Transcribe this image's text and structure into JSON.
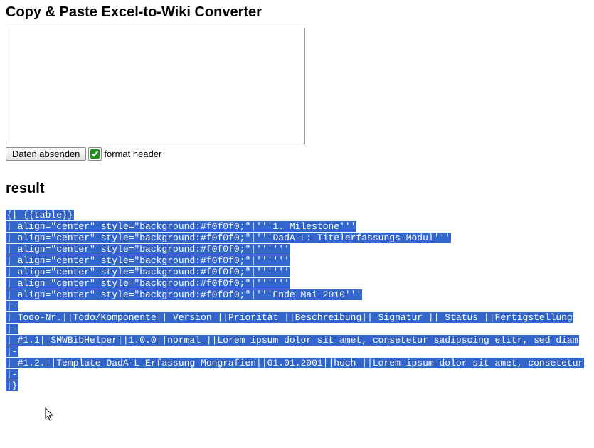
{
  "heading": "Copy & Paste Excel-to-Wiki Converter",
  "input": {
    "value": "",
    "placeholder": ""
  },
  "submit_label": "Daten absenden",
  "format_header": {
    "checked": true,
    "label": "format header"
  },
  "result_heading": "result",
  "result_lines": [
    "{| {{table}}",
    "| align=\"center\" style=\"background:#f0f0f0;\"|'''1. Milestone'''",
    "| align=\"center\" style=\"background:#f0f0f0;\"|'''DadA-L: Titelerfassungs-Modul'''",
    "| align=\"center\" style=\"background:#f0f0f0;\"|''''''",
    "| align=\"center\" style=\"background:#f0f0f0;\"|''''''",
    "| align=\"center\" style=\"background:#f0f0f0;\"|''''''",
    "| align=\"center\" style=\"background:#f0f0f0;\"|''''''",
    "| align=\"center\" style=\"background:#f0f0f0;\"|'''Ende Mai 2010'''",
    "|-",
    "| Todo-Nr.||Todo/Komponente|| Version ||Priorität ||Beschreibung|| Signatur || Status ||Fertigstellung",
    "|-",
    "| #1.1||SMWBibHelper||1.0.0||normal ||Lorem ipsum dolor sit amet, consetetur sadipscing elitr, sed diam ",
    "|-",
    "| #1.2.||Template DadA-L Erfassung Mongrafien||01.01.2001||hoch ||Lorem ipsum dolor sit amet, consetetur",
    "|-",
    "|}"
  ]
}
